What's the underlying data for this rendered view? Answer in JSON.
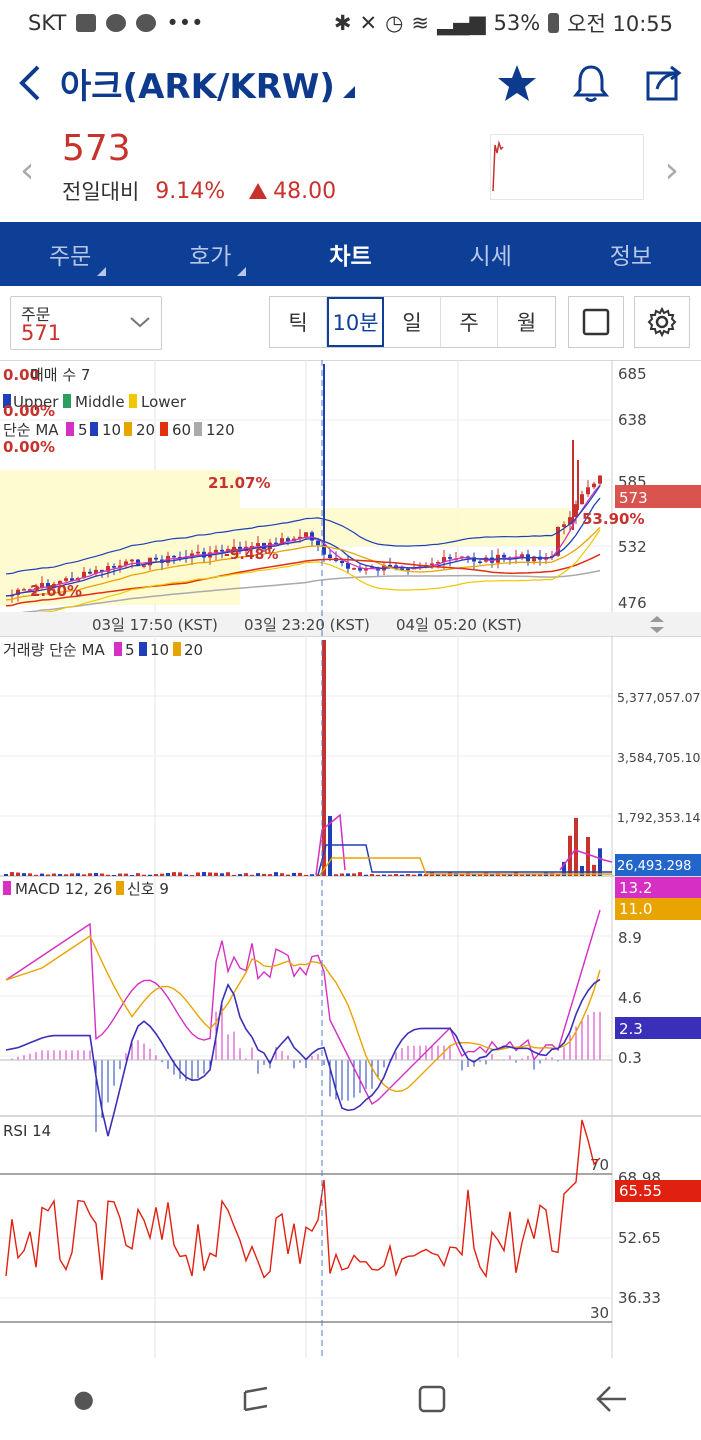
{
  "status_bar": {
    "carrier": "SKT",
    "battery": "53%",
    "time": "오전 10:55"
  },
  "header": {
    "title": "아크(ARK/KRW)"
  },
  "price": {
    "current": "573",
    "change_label": "전일대비",
    "change_pct": "9.14%",
    "change_abs": "48.00"
  },
  "tabs": [
    {
      "label": "주문",
      "active": false
    },
    {
      "label": "호가",
      "active": false
    },
    {
      "label": "차트",
      "active": true
    },
    {
      "label": "시세",
      "active": false
    },
    {
      "label": "정보",
      "active": false
    }
  ],
  "toolbar": {
    "order_label": "주문",
    "order_value": "571",
    "periods": [
      "틱",
      "10분",
      "일",
      "주",
      "월"
    ],
    "active_period": "10분"
  },
  "chart": {
    "price_panel": {
      "legend_env": "매매 수 7",
      "legend_env_prefix": "0.00",
      "bands": [
        "Upper",
        "Middle",
        "Lower"
      ],
      "ma_label": "단순 MA",
      "ma_periods": [
        "5",
        "10",
        "20",
        "60",
        "120"
      ],
      "zero_pct_1": "0.00%",
      "zero_pct_2": "0.00%",
      "pct_annot_1": "21.07%",
      "pct_annot_2": "2.60%",
      "pct_annot_3": "53.90%",
      "pct_annot_4": "-9.48%",
      "y_ticks": [
        "685",
        "638",
        "585",
        "532",
        "476"
      ],
      "current_price": "573",
      "x_ticks": [
        "03일 17:50 (KST)",
        "03일 23:20 (KST)",
        "04일 05:20 (KST)"
      ]
    },
    "volume_panel": {
      "label": "거래량 단순 MA",
      "ma_periods": [
        "5",
        "10",
        "20"
      ],
      "y_ticks": [
        "5,377,057.070",
        "3,584,705.107",
        "1,792,353.143"
      ],
      "current": "26,493.298"
    },
    "macd_panel": {
      "label": "MACD 12, 26",
      "signal_label": "신호 9",
      "macd_value": "13.2",
      "signal_value": "11.0",
      "hist_value": "2.3",
      "y_ticks": [
        "8.9",
        "4.6",
        "0.3"
      ]
    },
    "rsi_panel": {
      "label": "RSI 14",
      "upper": "70",
      "lower": "30",
      "y_ticks": [
        "68.98",
        "52.65",
        "36.33"
      ],
      "current": "65.55"
    }
  },
  "colors": {
    "brand_blue": "#0d3f97",
    "up_red": "#c8322c",
    "down_blue": "#1f3fb8",
    "macd_magenta": "#d62fc4",
    "signal_orange": "#e8a400",
    "rsi_red": "#e02010"
  }
}
